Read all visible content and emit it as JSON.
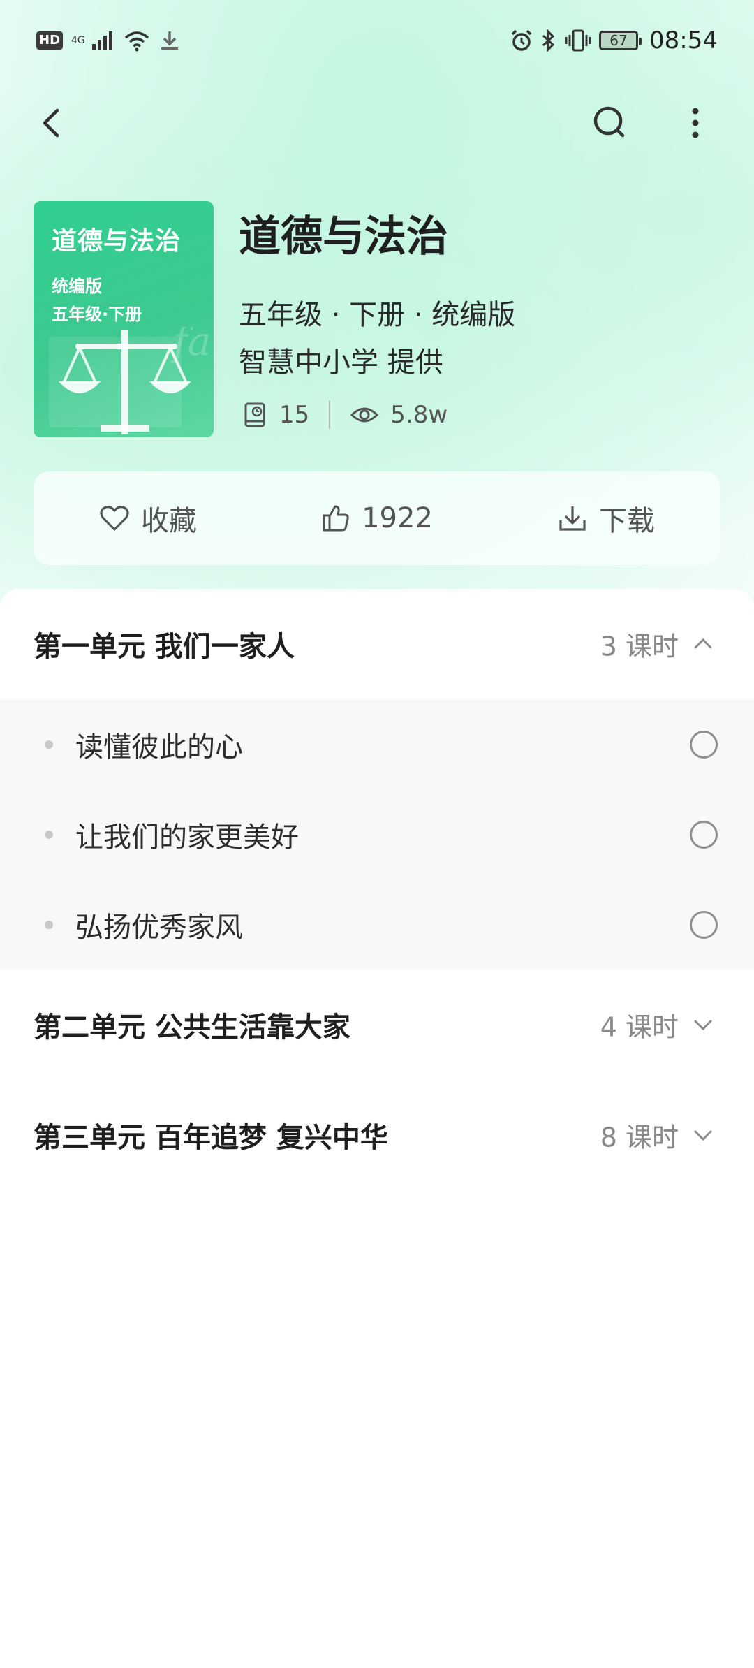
{
  "status_bar": {
    "hd": "HD",
    "network": "4G",
    "battery": "67",
    "time": "08:54"
  },
  "nav": {
    "back_icon": "back-arrow-icon",
    "search_icon": "search-icon",
    "more_icon": "more-vertical-icon"
  },
  "book": {
    "cover_title": "道德与法治",
    "cover_edition": "统编版",
    "cover_grade": "五年级·下册",
    "title": "道德与法治",
    "meta": "五年级 · 下册 · 统编版",
    "provider": "智慧中小学 提供",
    "lesson_count": "15",
    "views": "5.8w"
  },
  "actions": {
    "favorite": "收藏",
    "likes": "1922",
    "download": "下载"
  },
  "units": [
    {
      "title": "第一单元  我们一家人",
      "count": "3 课时",
      "expanded": true,
      "lessons": [
        "读懂彼此的心",
        "让我们的家更美好",
        "弘扬优秀家风"
      ]
    },
    {
      "title": "第二单元 公共生活靠大家",
      "count": "4 课时",
      "expanded": false
    },
    {
      "title": "第三单元 百年追梦 复兴中华",
      "count": "8 课时",
      "expanded": false
    }
  ],
  "colors": {
    "accent": "#3dc98f",
    "hero_bg": "#c2f7e1"
  }
}
